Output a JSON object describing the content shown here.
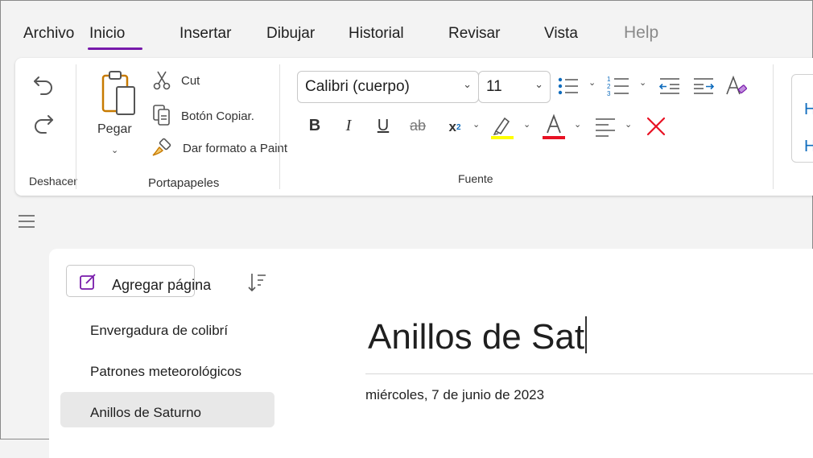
{
  "tabs": [
    {
      "label": "Archivo"
    },
    {
      "label": "Inicio"
    },
    {
      "label": "Insertar"
    },
    {
      "label": "Dibujar"
    },
    {
      "label": "Historial"
    },
    {
      "label": "Revisar"
    },
    {
      "label": "Vista"
    },
    {
      "label": "Help"
    }
  ],
  "ribbon": {
    "undo_group_label": "Deshacer",
    "clipboard": {
      "paste_label": "Pegar",
      "cut_label": "Cut",
      "copy_label": "Botón Copiar.",
      "format_painter_label": "Dar formato a Paint",
      "group_label": "Portapapeles"
    },
    "font": {
      "font_name": "Calibri (cuerpo)",
      "font_size": "11",
      "group_label": "Fuente",
      "highlight_color": "#ffff00",
      "font_color": "#e81123",
      "clear_color": "#e81123"
    }
  },
  "nav": {
    "add_page_label": "Agregar página",
    "pages": [
      {
        "label": "Envergadura de colibrí"
      },
      {
        "label": "Patrones meteorológicos"
      },
      {
        "label": "Anillos de Saturno"
      }
    ]
  },
  "page": {
    "title": "Anillos de Sat",
    "date": "miércoles, 7 de junio de 2023"
  },
  "colors": {
    "accent": "#7719aa",
    "icon_blue": "#0f6cbd"
  }
}
